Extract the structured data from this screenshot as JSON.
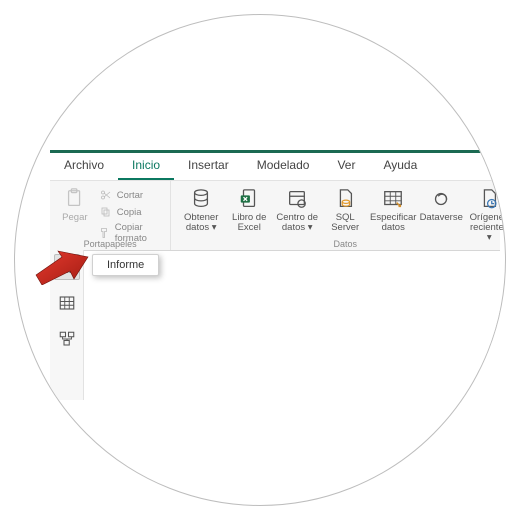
{
  "tabs": {
    "archivo": "Archivo",
    "inicio": "Inicio",
    "insertar": "Insertar",
    "modelado": "Modelado",
    "ver": "Ver",
    "ayuda": "Ayuda"
  },
  "clipboard": {
    "pegar": "Pegar",
    "cortar": "Cortar",
    "copia": "Copia",
    "copiar_formato": "Copiar formato",
    "group_label": "Portapapeles"
  },
  "data": {
    "obtener": "Obtener datos ▾",
    "excel": "Libro de Excel",
    "centro": "Centro de datos ▾",
    "sql": "SQL Server",
    "especificar": "Especificar datos",
    "dataverse": "Dataverse",
    "recientes": "Orígenes recientes ▾",
    "group_label": "Datos"
  },
  "rail": {
    "tooltip": "Informe"
  }
}
